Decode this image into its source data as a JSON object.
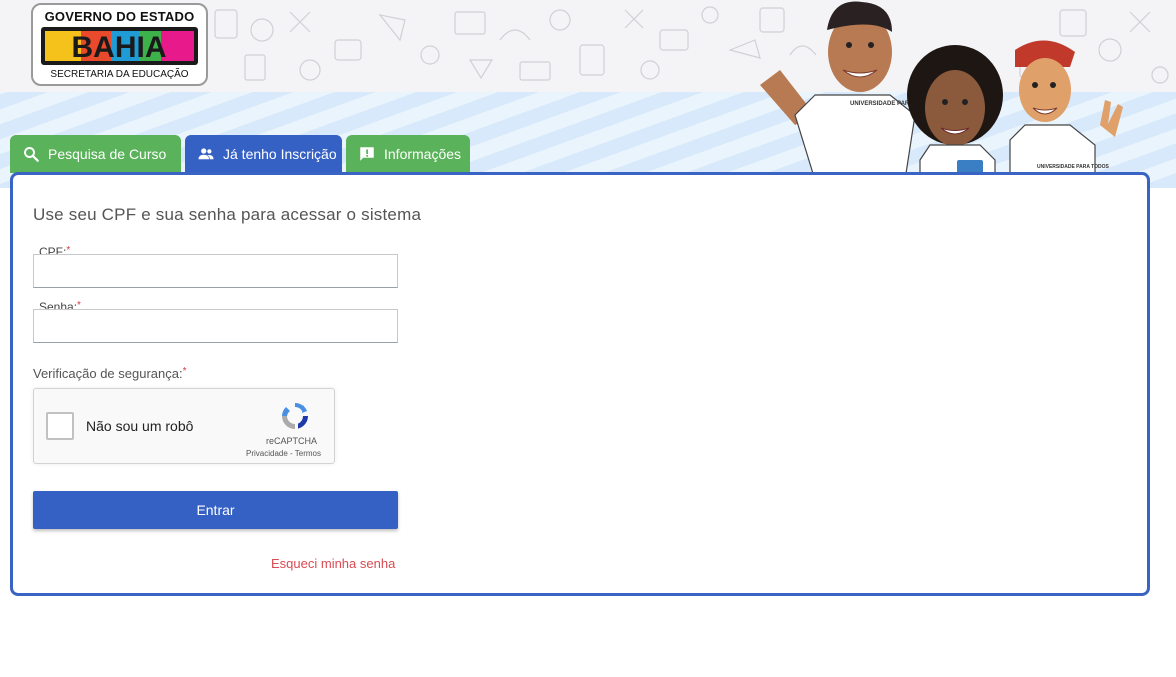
{
  "logo": {
    "top_text": "GOVERNO DO ESTADO",
    "main_text": "BAHIA",
    "bottom_text": "SECRETARIA DA EDUCAÇÃO"
  },
  "tabs": [
    {
      "label": "Pesquisa de Curso",
      "icon": "search-icon",
      "color": "#5ab25a"
    },
    {
      "label": "Já tenho Inscrição",
      "icon": "people-icon",
      "color": "#3561c5"
    },
    {
      "label": "Informações",
      "icon": "feedback-icon",
      "color": "#5ab25a"
    }
  ],
  "form": {
    "heading": "Use seu CPF e sua senha para acessar o sistema",
    "cpf_label": "CPF:",
    "cpf_value": "",
    "password_label": "Senha:",
    "password_value": "",
    "required_mark": "*",
    "security_label": "Verificação de segurança:",
    "submit_label": "Entrar",
    "forgot_label": "Esqueci minha senha"
  },
  "captcha": {
    "label": "Não sou um robô",
    "brand": "reCAPTCHA",
    "links": "Privacidade - Termos"
  },
  "mascots": [
    {
      "shirt_text": "UNIVERSIDADE PARA TODOS"
    },
    {
      "shirt_text": "UNIVERSIDADE PARA TODOS"
    }
  ],
  "colors": {
    "tab_green": "#5ab25a",
    "tab_blue": "#3561c5",
    "card_border": "#3a64c3",
    "forgot_link": "#d94b52"
  }
}
